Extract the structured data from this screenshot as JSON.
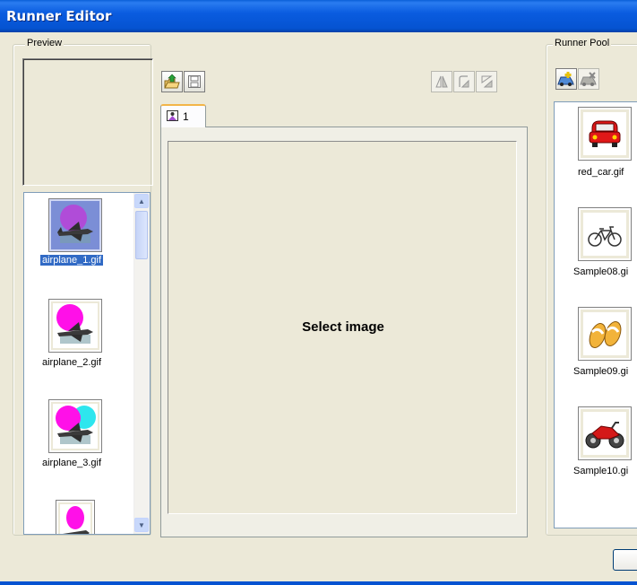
{
  "window": {
    "title": "Runner Editor"
  },
  "preview": {
    "label": "Preview",
    "images": [
      {
        "name": "airplane_1.gif",
        "selected": true
      },
      {
        "name": "airplane_2.gif",
        "selected": false
      },
      {
        "name": "airplane_3.gif",
        "selected": false
      },
      {
        "name": "",
        "selected": false
      }
    ]
  },
  "editor": {
    "tab_label": "1",
    "canvas_text": "Select image"
  },
  "runner_pool": {
    "label": "Runner Pool",
    "items": [
      {
        "name": "red_car.gif",
        "icon": "car-icon"
      },
      {
        "name": "Sample08.gi",
        "icon": "bicycle-icon"
      },
      {
        "name": "Sample09.gi",
        "icon": "sandals-icon"
      },
      {
        "name": "Sample10.gi",
        "icon": "motorcycle-icon"
      }
    ]
  },
  "colors": {
    "title_bar": "#0a5ce0",
    "selection": "#316ac5",
    "window_bg": "#ece9d8"
  }
}
